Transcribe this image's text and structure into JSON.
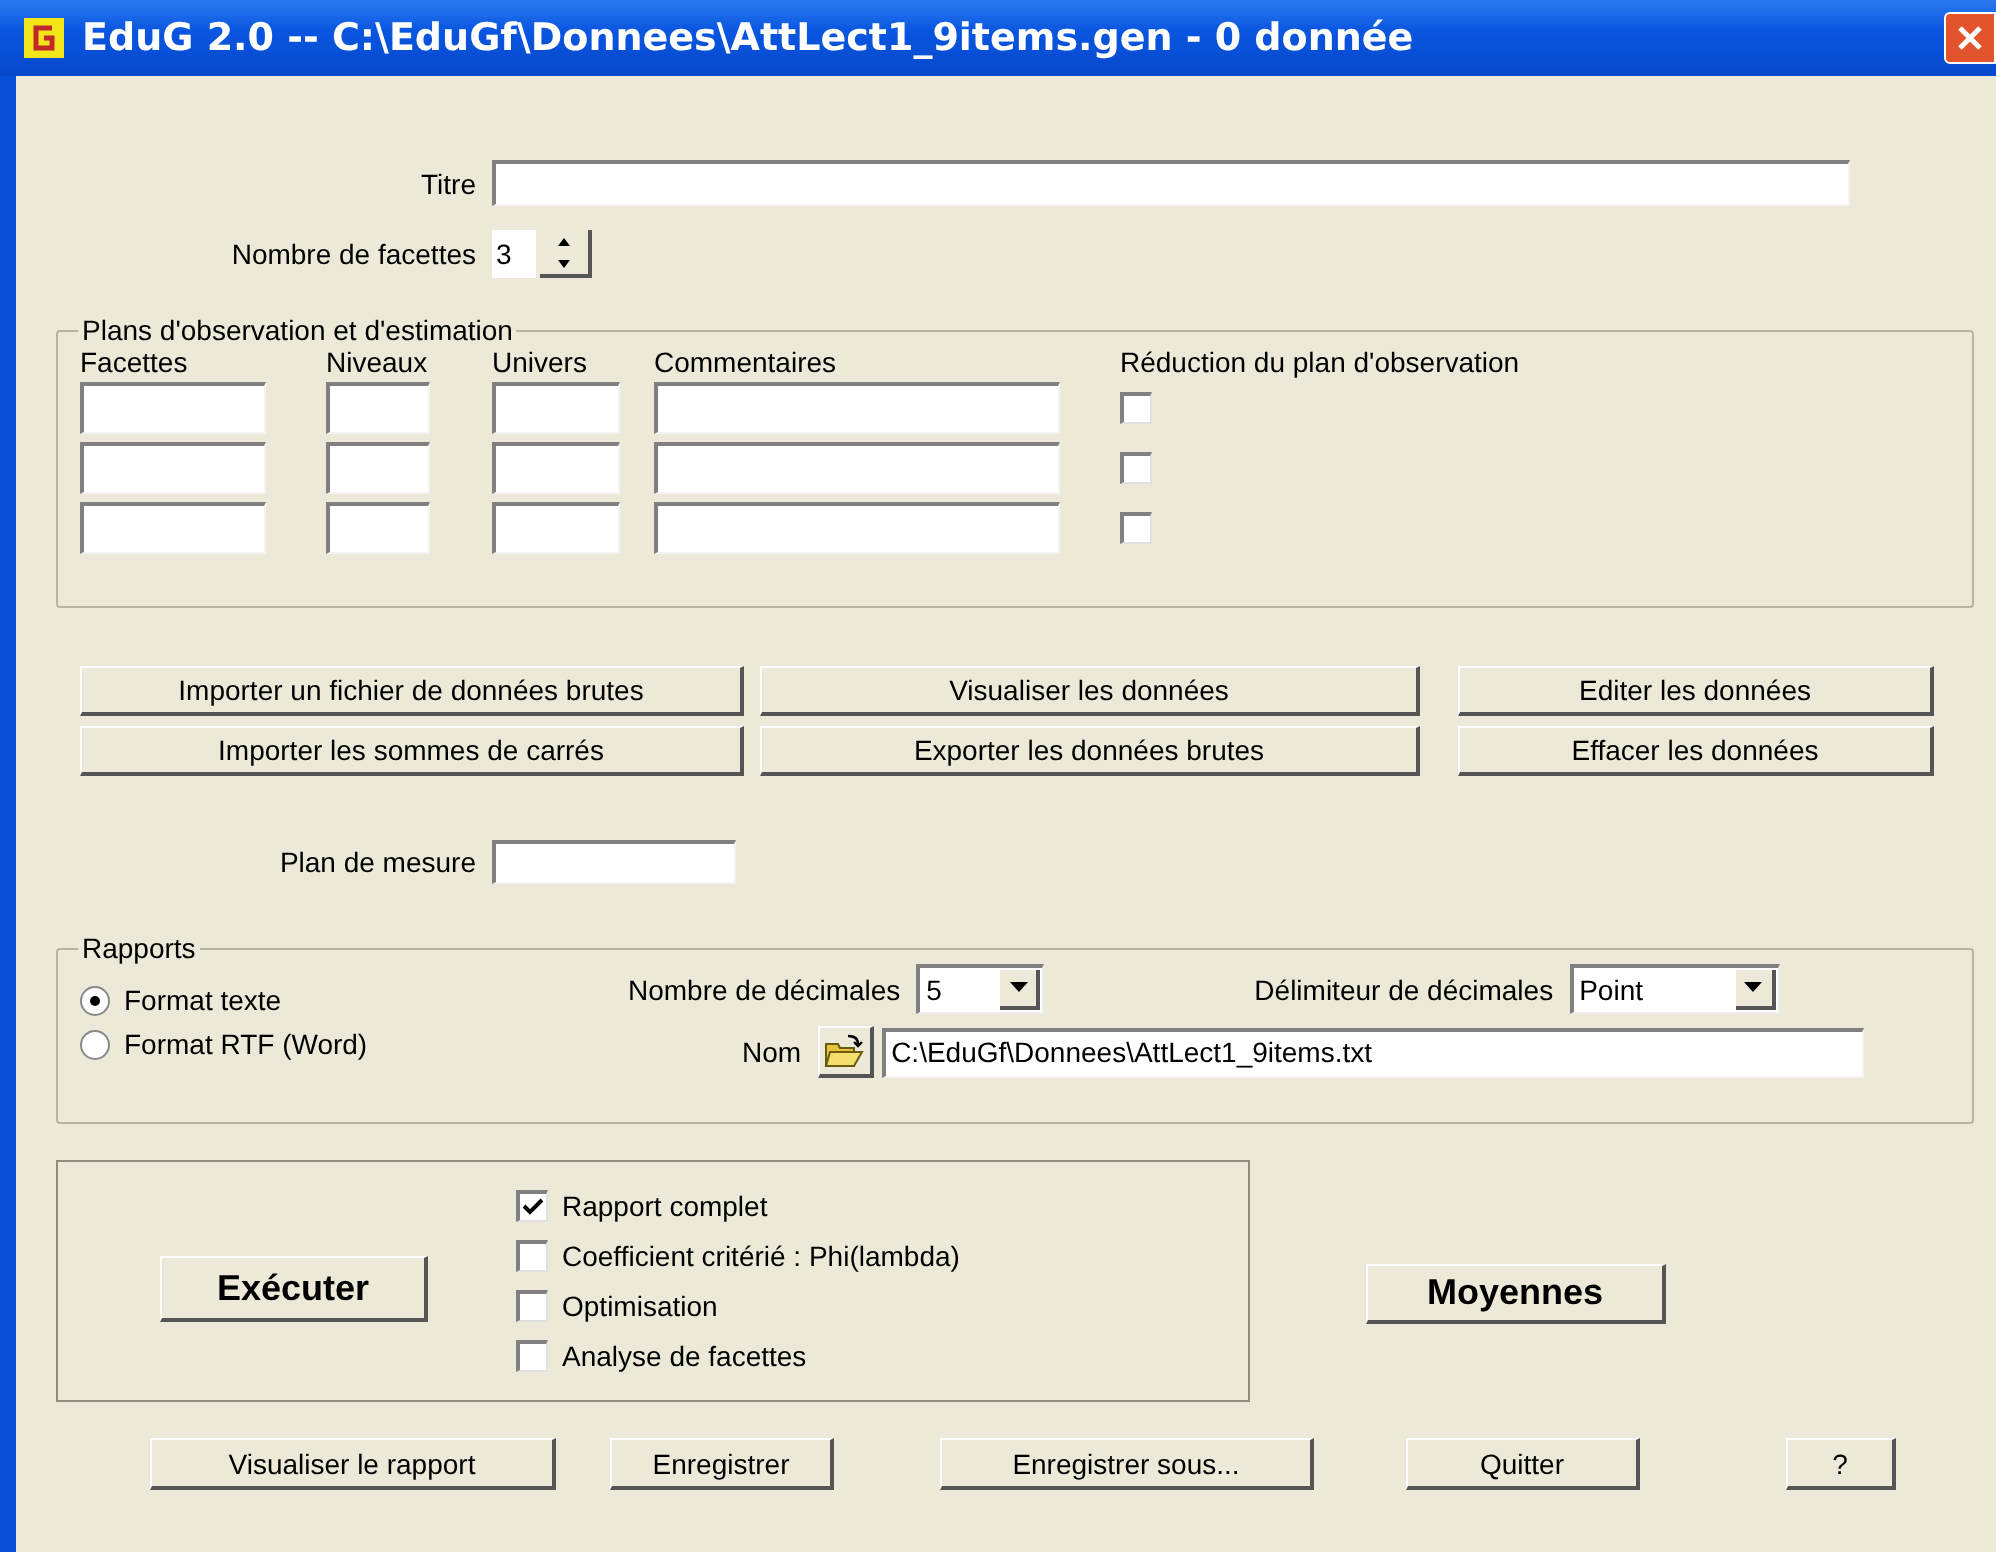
{
  "window": {
    "title": "EduG 2.0 -- C:\\EduGf\\Donnees\\AttLect1_9items.gen - 0 donnée"
  },
  "title_field": {
    "label": "Titre"
  },
  "facet_count": {
    "label": "Nombre de facettes",
    "value": "3"
  },
  "observation_plan": {
    "legend": "Plans d'observation et d'estimation",
    "columns": [
      "Facettes",
      "Niveaux",
      "Univers",
      "Commentaires",
      "Réduction du plan d'observation"
    ],
    "rows": [
      {
        "reduction": false
      },
      {
        "reduction": false
      },
      {
        "reduction": false
      }
    ]
  },
  "data_buttons": [
    "Importer un fichier de données brutes",
    "Visualiser les données",
    "Editer les données",
    "Importer les sommes de carrés",
    "Exporter les données brutes",
    "Effacer les données"
  ],
  "measure_plan": {
    "label": "Plan de mesure"
  },
  "reports": {
    "legend": "Rapports",
    "formats": [
      {
        "label": "Format texte",
        "selected": true
      },
      {
        "label": "Format RTF (Word)",
        "selected": false
      }
    ],
    "decimals": {
      "label": "Nombre de décimales",
      "value": "5"
    },
    "delimiter": {
      "label": "Délimiteur de décimales",
      "value": "Point"
    },
    "name": {
      "label": "Nom",
      "value": "C:\\EduGf\\Donnees\\AttLect1_9items.txt"
    }
  },
  "execute_button": "Exécuter",
  "options": [
    {
      "label": "Rapport complet",
      "checked": true
    },
    {
      "label": "Coefficient critérié : Phi(lambda)",
      "checked": false
    },
    {
      "label": "Optimisation",
      "checked": false
    },
    {
      "label": "Analyse de facettes",
      "checked": false
    }
  ],
  "means_button": "Moyennes",
  "bottom_buttons": [
    "Visualiser le rapport",
    "Enregistrer",
    "Enregistrer sous...",
    "Quitter",
    "?"
  ]
}
